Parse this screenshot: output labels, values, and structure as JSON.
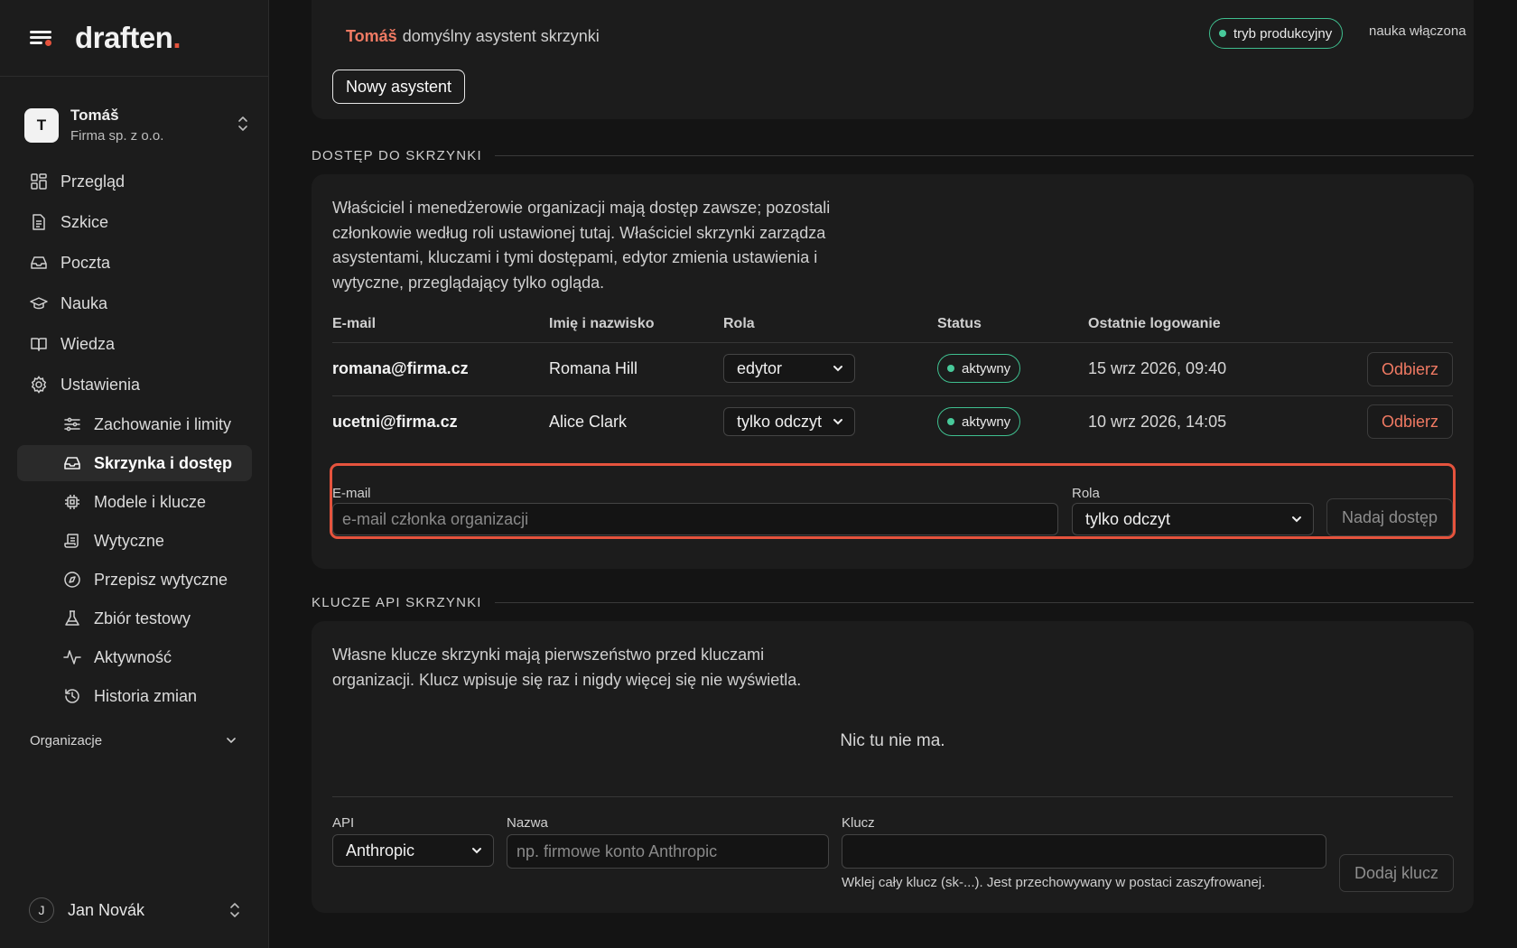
{
  "brand": {
    "logo_text": "draften",
    "logo_dot": "."
  },
  "org": {
    "avatar": "T",
    "name": "Tomáš",
    "subtitle": "Firma sp. z o.o."
  },
  "nav": [
    {
      "label": "Przegląd",
      "icon": "dashboard-icon"
    },
    {
      "label": "Szkice",
      "icon": "document-icon"
    },
    {
      "label": "Poczta",
      "icon": "inbox-icon"
    },
    {
      "label": "Nauka",
      "icon": "graduation-cap-icon"
    },
    {
      "label": "Wiedza",
      "icon": "book-icon"
    },
    {
      "label": "Ustawienia",
      "icon": "gear-icon"
    }
  ],
  "subnav": [
    {
      "label": "Zachowanie i limity",
      "icon": "sliders-icon"
    },
    {
      "label": "Skrzynka i dostęp",
      "icon": "inbox-icon",
      "active": true
    },
    {
      "label": "Modele i klucze",
      "icon": "chip-icon"
    },
    {
      "label": "Wytyczne",
      "icon": "scroll-icon"
    },
    {
      "label": "Przepisz wytyczne",
      "icon": "compass-icon"
    },
    {
      "label": "Zbiór testowy",
      "icon": "flask-icon"
    },
    {
      "label": "Aktywność",
      "icon": "activity-icon"
    },
    {
      "label": "Historia zmian",
      "icon": "history-icon"
    }
  ],
  "sections_sidebar": {
    "organizations": "Organizacje"
  },
  "user": {
    "avatar": "J",
    "name": "Jan Novák"
  },
  "assistant": {
    "name": "Tomáš",
    "description": "domyślny asystent skrzynki",
    "mode_badge": "tryb produkcyjny",
    "learning": "nauka włączona",
    "new_button": "Nowy asystent"
  },
  "access": {
    "heading": "DOSTĘP DO SKRZYNKI",
    "intro": "Właściciel i menedżerowie organizacji mają dostęp zawsze; pozostali członkowie według roli ustawionej tutaj. Właściciel skrzynki zarządza asystentami, kluczami i tymi dostępami, edytor zmienia ustawienia i wytyczne, przeglądający tylko ogląda.",
    "columns": [
      "E-mail",
      "Imię i nazwisko",
      "Rola",
      "Status",
      "Ostatnie logowanie"
    ],
    "rows": [
      {
        "email": "romana@firma.cz",
        "name": "Romana Hill",
        "role": "edytor",
        "status": "aktywny",
        "last_login": "15 wrz 2026, 09:40",
        "action": "Odbierz"
      },
      {
        "email": "ucetni@firma.cz",
        "name": "Alice Clark",
        "role": "tylko odczyt",
        "status": "aktywny",
        "last_login": "10 wrz 2026, 14:05",
        "action": "Odbierz"
      }
    ],
    "grant": {
      "email_label": "E-mail",
      "email_placeholder": "e-mail członka organizacji",
      "role_label": "Rola",
      "role_value": "tylko odczyt",
      "button": "Nadaj dostęp"
    }
  },
  "keys": {
    "heading": "KLUCZE API SKRZYNKI",
    "intro": "Własne klucze skrzynki mają pierwszeństwo przed kluczami organizacji. Klucz wpisuje się raz i nigdy więcej się nie wyświetla.",
    "empty": "Nic tu nie ma.",
    "form": {
      "api_label": "API",
      "api_value": "Anthropic",
      "name_label": "Nazwa",
      "name_placeholder": "np. firmowe konto Anthropic",
      "key_label": "Klucz",
      "key_value": "",
      "hint": "Wklej cały klucz (sk-...). Jest przechowywany w postaci zaszyfrowanej.",
      "button": "Dodaj klucz"
    }
  },
  "colors": {
    "accent": "#e5533d",
    "accent_text": "#f07a63",
    "status_green": "#3fbf8f",
    "background": "#141414",
    "card": "#1c1c1c"
  }
}
